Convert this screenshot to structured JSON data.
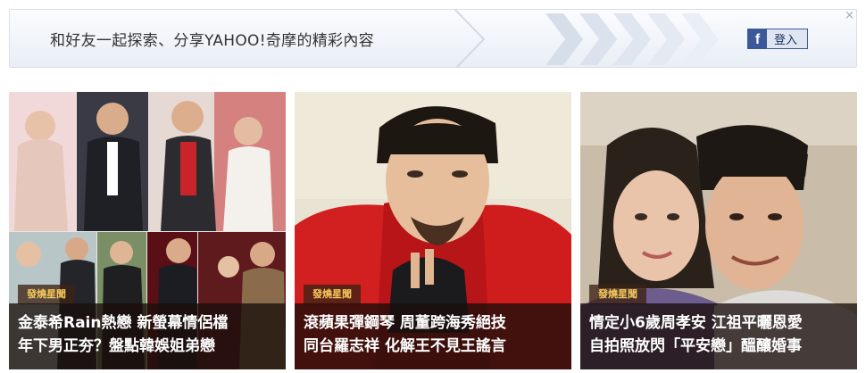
{
  "banner": {
    "text": "和好友一起探索、分享YAHOO!奇摩的精彩內容",
    "facebook_logo": "f",
    "login_label": "登入",
    "close_symbol": "×"
  },
  "cards": [
    {
      "tag": "發燒星聞",
      "title_line1": "金泰希Rain熱戀 新螢幕情侶檔",
      "title_line2": "年下男正夯？盤點韓娛姐弟戀"
    },
    {
      "tag": "發燒星聞",
      "title_line1": "滾蘋果彈鋼琴 周董跨海秀絕技",
      "title_line2": "同台羅志祥 化解王不見王謠言"
    },
    {
      "tag": "發燒星聞",
      "title_line1": "情定小6歲周孝安 江祖平曬恩愛",
      "title_line2": "自拍照放閃「平安戀」醞釀婚事"
    }
  ]
}
